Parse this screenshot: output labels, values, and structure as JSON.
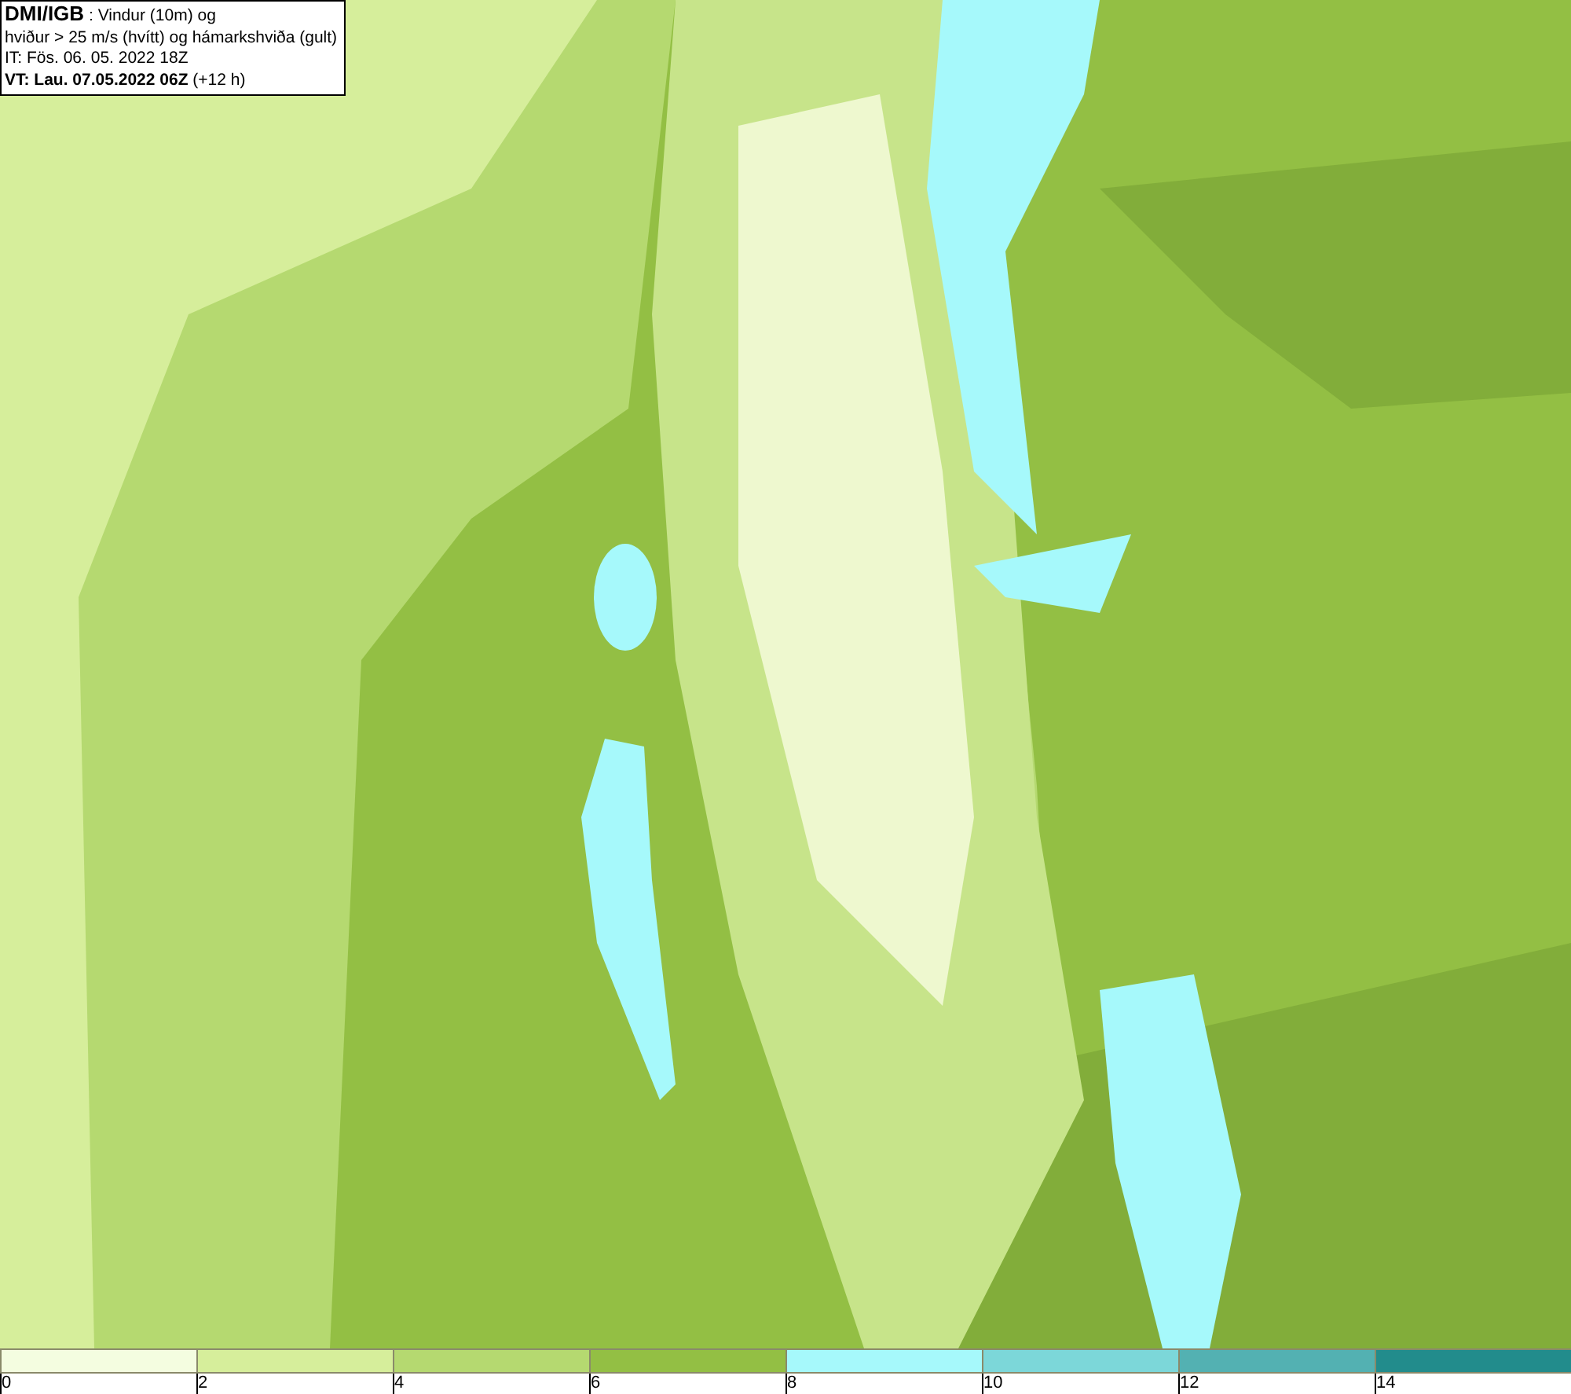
{
  "info_box": {
    "lines": [
      "**DMI/IGB** : Vindur (10m) og",
      "hviður > 25 m/s (hvítt) og hámarkshviða (gult)",
      "IT: Fös. 06. 05. 2022 18Z",
      "**VT: Lau. 07.05.2022 06Z** (+12 h)"
    ]
  },
  "legend": [
    {
      "color": "#f4fde0",
      "label": "0"
    },
    {
      "color": "#d6ee9b",
      "label": "2"
    },
    {
      "color": "#b5d970",
      "label": "4"
    },
    {
      "color": "#93bf44",
      "label": "6"
    },
    {
      "color": "#a6f9fb",
      "label": "8"
    },
    {
      "color": "#7cd7d9",
      "label": "10"
    },
    {
      "color": "#53b1b2",
      "label": "12"
    },
    {
      "color": "#228c8c",
      "label": "14"
    }
  ]
}
